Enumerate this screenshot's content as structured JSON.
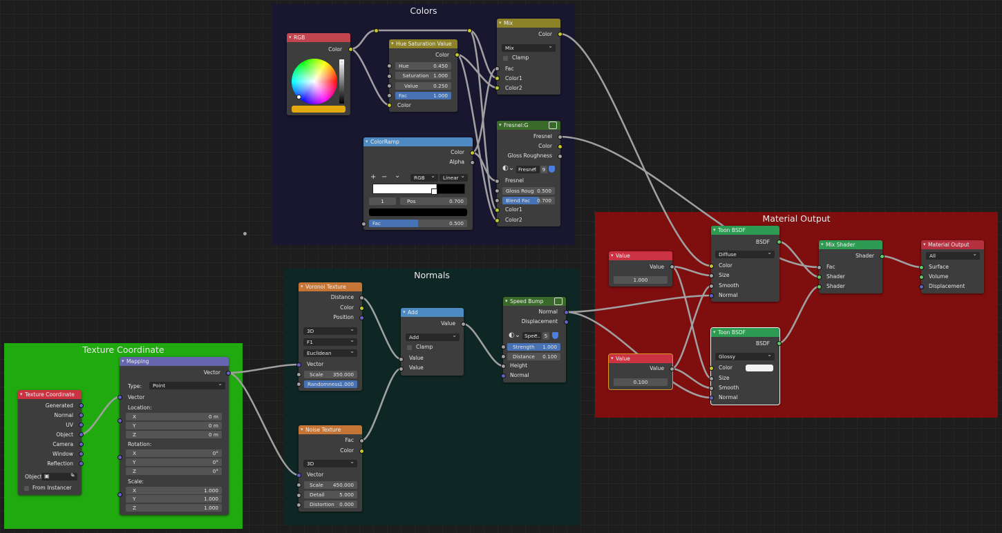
{
  "frames": {
    "colors": "Colors",
    "normals": "Normals",
    "texcoord": "Texture Coordinate",
    "matout": "Material Output"
  },
  "colors": {
    "header_rgb": "#c2444f",
    "header_converter": "#8e8228",
    "header_ramp": "#4d8ac1",
    "header_group": "#3a6a2a",
    "header_texture": "#c57637",
    "header_vector": "#6565b0",
    "header_shader": "#2e9b52",
    "header_input": "#cb3343",
    "header_output": "#b5303e",
    "frame_colors": "#18172f",
    "frame_normals": "#0e2724",
    "frame_texcoord": "#21aa10",
    "frame_matout": "#7f0e0e",
    "wire": "#a0a0a0",
    "accent": "#4772b3"
  },
  "rgb": {
    "title": "RGB",
    "out": "Color",
    "swatch": "#e4a90d"
  },
  "hsv": {
    "title": "Hue Saturation Value",
    "out": "Color",
    "hue_l": "Hue",
    "hue_v": "0.450",
    "sat_l": "Saturation",
    "sat_v": "1.000",
    "val_l": "Value",
    "val_v": "0.250",
    "fac_l": "Fac",
    "fac_v": "1.000",
    "in_color": "Color"
  },
  "mix": {
    "title": "Mix",
    "out": "Color",
    "mode": "Mix",
    "clamp": "Clamp",
    "fac": "Fac",
    "c1": "Color1",
    "c2": "Color2"
  },
  "ramp": {
    "title": "ColorRamp",
    "out_color": "Color",
    "out_alpha": "Alpha",
    "mode": "RGB",
    "interp": "Linear",
    "index": "1",
    "pos_l": "Pos",
    "pos_v": "0.700",
    "fac_l": "Fac",
    "fac_v": "0.500",
    "add": "+",
    "remove": "−",
    "menu": "⌄"
  },
  "fresnel": {
    "title": "Fresnel:G",
    "out_fresnel": "Fresnel",
    "out_color": "Color",
    "out_gloss": "Gloss Roughness",
    "group_name": "Fresnel",
    "users": "9",
    "in_fresnel": "Fresnel",
    "gloss_l": "Gloss Roug",
    "gloss_v": "0.500",
    "blend_l": "Blend Fac",
    "blend_v": "0.700",
    "c1": "Color1",
    "c2": "Color2"
  },
  "voronoi": {
    "title": "Voronoi Texture",
    "out_dist": "Distance",
    "out_color": "Color",
    "out_pos": "Position",
    "dim": "3D",
    "feature": "F1",
    "metric": "Euclidean",
    "in_vector": "Vector",
    "scale_l": "Scale",
    "scale_v": "350.000",
    "rand_l": "Randomness",
    "rand_v": "1.000"
  },
  "noise": {
    "title": "Noise Texture",
    "out_fac": "Fac",
    "out_color": "Color",
    "dim": "3D",
    "in_vector": "Vector",
    "scale_l": "Scale",
    "scale_v": "450.000",
    "detail_l": "Detail",
    "detail_v": "5.000",
    "dist_l": "Distortion",
    "dist_v": "0.000"
  },
  "add": {
    "title": "Add",
    "out": "Value",
    "op": "Add",
    "clamp": "Clamp",
    "in1": "Value",
    "in2": "Value"
  },
  "bump": {
    "title": "Speed Bump",
    "out_normal": "Normal",
    "out_disp": "Displacement",
    "group_name": "Spee..",
    "users": "5",
    "str_l": "Strength",
    "str_v": "1.000",
    "dist_l": "Distance",
    "dist_v": "0.100",
    "height": "Height",
    "normal": "Normal"
  },
  "texcoord": {
    "title": "Texture Coordinate",
    "outs": [
      "Generated",
      "Normal",
      "UV",
      "Object",
      "Camera",
      "Window",
      "Reflection"
    ],
    "object_l": "Object",
    "instancer": "From Instancer"
  },
  "mapping": {
    "title": "Mapping",
    "out": "Vector",
    "type_l": "Type:",
    "type_v": "Point",
    "vector": "Vector",
    "loc_l": "Location:",
    "rot_l": "Rotation:",
    "scale_l": "Scale:",
    "x": "X",
    "y": "Y",
    "z": "Z",
    "loc": [
      "0 m",
      "0 m",
      "0 m"
    ],
    "rot": [
      "0°",
      "0°",
      "0°"
    ],
    "scl": [
      "1.000",
      "1.000",
      "1.000"
    ]
  },
  "value1": {
    "title": "Value",
    "out": "Value",
    "v": "1.000"
  },
  "value2": {
    "title": "Value",
    "out": "Value",
    "v": "0.100"
  },
  "toon1": {
    "title": "Toon BSDF",
    "out": "BSDF",
    "comp": "Diffuse",
    "color": "Color",
    "size": "Size",
    "smooth": "Smooth",
    "normal": "Normal"
  },
  "toon2": {
    "title": "Toon BSDF",
    "out": "BSDF",
    "comp": "Glossy",
    "color": "Color",
    "size": "Size",
    "smooth": "Smooth",
    "normal": "Normal"
  },
  "mixshader": {
    "title": "Mix Shader",
    "out": "Shader",
    "fac": "Fac",
    "s1": "Shader",
    "s2": "Shader"
  },
  "matout": {
    "title": "Material Output",
    "target": "All",
    "surface": "Surface",
    "volume": "Volume",
    "disp": "Displacement"
  }
}
